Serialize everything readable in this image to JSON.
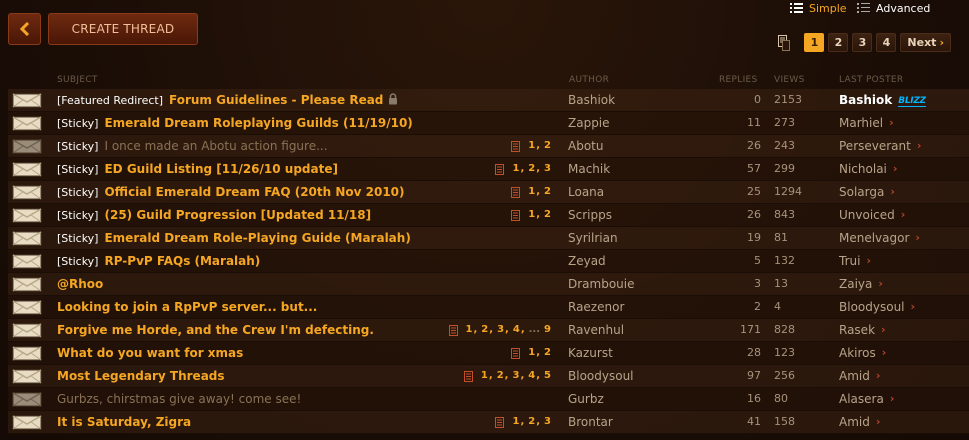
{
  "toolbar": {
    "create_label": "CREATE THREAD",
    "back_icon": "chevron-left-icon"
  },
  "view": {
    "simple": "Simple",
    "advanced": "Advanced"
  },
  "pager": {
    "pages": [
      "1",
      "2",
      "3",
      "4"
    ],
    "current": "1",
    "next": "Next"
  },
  "columns": {
    "subject": "SUBJECT",
    "author": "AUTHOR",
    "replies": "REPLIES",
    "views": "VIEWS",
    "last_poster": "LAST POSTER"
  },
  "colors": {
    "accent": "#f5a623",
    "button": "#5a1f0a",
    "blizzard": "#00b4ff"
  },
  "threads": [
    {
      "prefix": "[Featured Redirect]",
      "title": "Forum Guidelines - Please Read",
      "locked": true,
      "read": false,
      "pages": [],
      "author": "Bashiok",
      "replies": "0",
      "views": "2153",
      "last": "Bashiok",
      "last_bold": true,
      "blizz": "BLIZZ"
    },
    {
      "prefix": "[Sticky]",
      "title": "Emerald Dream Roleplaying Guilds (11/19/10)",
      "read": false,
      "pages": [],
      "author": "Zappie",
      "replies": "11",
      "views": "273",
      "last": "Marhiel"
    },
    {
      "prefix": "[Sticky]",
      "title": "I once made an Abotu action figure...",
      "read": true,
      "pages": [
        "1",
        "2"
      ],
      "author": "Abotu",
      "replies": "26",
      "views": "243",
      "last": "Perseverant"
    },
    {
      "prefix": "[Sticky]",
      "title": "ED Guild Listing [11/26/10 update]",
      "read": false,
      "pages": [
        "1",
        "2",
        "3"
      ],
      "author": "Machik",
      "replies": "57",
      "views": "299",
      "last": "Nicholai"
    },
    {
      "prefix": "[Sticky]",
      "title": "Official Emerald Dream FAQ (20th Nov 2010)",
      "read": false,
      "pages": [
        "1",
        "2"
      ],
      "author": "Loana",
      "replies": "25",
      "views": "1294",
      "last": "Solarga"
    },
    {
      "prefix": "[Sticky]",
      "title": "(25) Guild Progression [Updated 11/18]",
      "read": false,
      "pages": [
        "1",
        "2"
      ],
      "author": "Scripps",
      "replies": "26",
      "views": "843",
      "last": "Unvoiced"
    },
    {
      "prefix": "[Sticky]",
      "title": "Emerald Dream Role-Playing Guide (Maralah)",
      "read": false,
      "pages": [],
      "author": "Syrilrian",
      "replies": "19",
      "views": "81",
      "last": "Menelvagor"
    },
    {
      "prefix": "[Sticky]",
      "title": "RP-PvP FAQs (Maralah)",
      "read": false,
      "pages": [],
      "author": "Zeyad",
      "replies": "5",
      "views": "132",
      "last": "Trui"
    },
    {
      "prefix": "",
      "title": "@Rhoo",
      "read": false,
      "pages": [],
      "author": "Drambouie",
      "replies": "3",
      "views": "13",
      "last": "Zaiya"
    },
    {
      "prefix": "",
      "title": "Looking to join a RpPvP server... but...",
      "read": false,
      "pages": [],
      "author": "Raezenor",
      "replies": "2",
      "views": "4",
      "last": "Bloodysoul"
    },
    {
      "prefix": "",
      "title": "Forgive me Horde, and the Crew I'm defecting.",
      "read": false,
      "pages": [
        "1",
        "2",
        "3",
        "4",
        "...",
        "9"
      ],
      "author": "Ravenhul",
      "replies": "171",
      "views": "828",
      "last": "Rasek"
    },
    {
      "prefix": "",
      "title": "What do you want for xmas",
      "read": false,
      "pages": [
        "1",
        "2"
      ],
      "author": "Kazurst",
      "replies": "28",
      "views": "123",
      "last": "Akiros"
    },
    {
      "prefix": "",
      "title": "Most Legendary Threads",
      "read": false,
      "pages": [
        "1",
        "2",
        "3",
        "4",
        "5"
      ],
      "author": "Bloodysoul",
      "replies": "97",
      "views": "256",
      "last": "Amid"
    },
    {
      "prefix": "",
      "title": "Gurbzs, chirstmas give away! come see!",
      "read": true,
      "pages": [],
      "author": "Gurbz",
      "replies": "16",
      "views": "80",
      "last": "Alasera"
    },
    {
      "prefix": "",
      "title": "It is Saturday, Zigra",
      "read": false,
      "pages": [
        "1",
        "2",
        "3"
      ],
      "author": "Brontar",
      "replies": "41",
      "views": "158",
      "last": "Amid"
    }
  ]
}
